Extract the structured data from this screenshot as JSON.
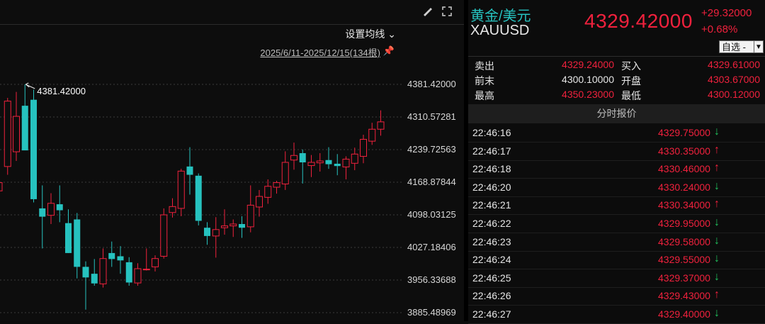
{
  "chart": {
    "ma_selector": "设置均线",
    "date_range": "2025/6/11-2025/12/15(134根)",
    "icons": {
      "draw": "brush-icon",
      "fullscreen": "expand-icon",
      "pin": "pin-icon"
    },
    "high_marker": "4381.42000",
    "y_ticks": [
      "4381.42000",
      "4310.57281",
      "4239.72563",
      "4168.87844",
      "4098.03125",
      "4027.18406",
      "3956.33688",
      "3885.48969"
    ]
  },
  "chart_data": {
    "type": "candlestick",
    "ylim": [
      3885.48969,
      4381.42
    ],
    "up_color": "#f0213d",
    "down_color": "#26c2bf",
    "candles": [
      {
        "o": 4150,
        "h": 4185,
        "l": 4138,
        "c": 4168
      },
      {
        "o": 4203,
        "h": 4352,
        "l": 4185,
        "c": 4345
      },
      {
        "o": 4235,
        "h": 4365,
        "l": 4215,
        "c": 4312
      },
      {
        "o": 4335,
        "h": 4381.42,
        "l": 4272,
        "c": 4238
      },
      {
        "o": 4348,
        "h": 4370,
        "l": 4125,
        "c": 4132
      },
      {
        "o": 4112,
        "h": 4162,
        "l": 4025,
        "c": 4094
      },
      {
        "o": 4097,
        "h": 4145,
        "l": 4078,
        "c": 4123
      },
      {
        "o": 4121,
        "h": 4162,
        "l": 4082,
        "c": 4108
      },
      {
        "o": 4080,
        "h": 4110,
        "l": 4015,
        "c": 4015
      },
      {
        "o": 4088,
        "h": 4102,
        "l": 3960,
        "c": 3985
      },
      {
        "o": 3985,
        "h": 3997,
        "l": 3892,
        "c": 3962
      },
      {
        "o": 3970,
        "h": 4002,
        "l": 3944,
        "c": 3949
      },
      {
        "o": 3948,
        "h": 4025,
        "l": 3940,
        "c": 4003
      },
      {
        "o": 4015,
        "h": 4040,
        "l": 3985,
        "c": 4002
      },
      {
        "o": 4008,
        "h": 4030,
        "l": 3970,
        "c": 3999
      },
      {
        "o": 3995,
        "h": 4006,
        "l": 3944,
        "c": 3951
      },
      {
        "o": 3950,
        "h": 3993,
        "l": 3944,
        "c": 3981
      },
      {
        "o": 3980,
        "h": 4025,
        "l": 3977,
        "c": 3980
      },
      {
        "o": 3985,
        "h": 4010,
        "l": 3975,
        "c": 4003
      },
      {
        "o": 4008,
        "h": 4112,
        "l": 4003,
        "c": 4098
      },
      {
        "o": 4103,
        "h": 4134,
        "l": 4092,
        "c": 4116
      },
      {
        "o": 4112,
        "h": 4198,
        "l": 4095,
        "c": 4193
      },
      {
        "o": 4203,
        "h": 4245,
        "l": 4142,
        "c": 4185
      },
      {
        "o": 4183,
        "h": 4188,
        "l": 4075,
        "c": 4085
      },
      {
        "o": 4070,
        "h": 4082,
        "l": 4033,
        "c": 4052
      },
      {
        "o": 4052,
        "h": 4093,
        "l": 4005,
        "c": 4066
      },
      {
        "o": 4070,
        "h": 4110,
        "l": 4055,
        "c": 4074
      },
      {
        "o": 4074,
        "h": 4088,
        "l": 4050,
        "c": 4078
      },
      {
        "o": 4078,
        "h": 4095,
        "l": 4048,
        "c": 4070
      },
      {
        "o": 4072,
        "h": 4162,
        "l": 4060,
        "c": 4119
      },
      {
        "o": 4115,
        "h": 4152,
        "l": 4094,
        "c": 4138
      },
      {
        "o": 4136,
        "h": 4175,
        "l": 4122,
        "c": 4160
      },
      {
        "o": 4158,
        "h": 4172,
        "l": 4144,
        "c": 4168
      },
      {
        "o": 4165,
        "h": 4236,
        "l": 4152,
        "c": 4212
      },
      {
        "o": 4217,
        "h": 4255,
        "l": 4196,
        "c": 4227
      },
      {
        "o": 4232,
        "h": 4240,
        "l": 4166,
        "c": 4212
      },
      {
        "o": 4205,
        "h": 4228,
        "l": 4180,
        "c": 4212
      },
      {
        "o": 4211,
        "h": 4232,
        "l": 4192,
        "c": 4215
      },
      {
        "o": 4217,
        "h": 4245,
        "l": 4198,
        "c": 4208
      },
      {
        "o": 4209,
        "h": 4230,
        "l": 4184,
        "c": 4204
      },
      {
        "o": 4202,
        "h": 4225,
        "l": 4175,
        "c": 4219
      },
      {
        "o": 4210,
        "h": 4244,
        "l": 4195,
        "c": 4230
      },
      {
        "o": 4225,
        "h": 4272,
        "l": 4210,
        "c": 4262
      },
      {
        "o": 4258,
        "h": 4298,
        "l": 4250,
        "c": 4284
      },
      {
        "o": 4284,
        "h": 4325,
        "l": 4270,
        "c": 4300
      }
    ]
  },
  "quote": {
    "symbol_cn": "黄金/美元",
    "symbol_en": "XAUUSD",
    "last": "4329.42000",
    "change": "+29.32000",
    "change_pct": "+0.68%",
    "watch_label": "自选 -",
    "rows": [
      {
        "l1": "卖出",
        "v1": "4329.24000",
        "l2": "买入",
        "v2": "4329.61000"
      },
      {
        "l1": "前末",
        "v1": "4300.10000",
        "l2": "开盘",
        "v2": "4303.67000"
      },
      {
        "l1": "最高",
        "v1": "4350.23000",
        "l2": "最低",
        "v2": "4300.12000"
      }
    ],
    "ticks_header": "分时报价",
    "ticks": [
      {
        "time": "22:46:16",
        "price": "4329.75000",
        "dir": "down"
      },
      {
        "time": "22:46:17",
        "price": "4330.35000",
        "dir": "up"
      },
      {
        "time": "22:46:18",
        "price": "4330.46000",
        "dir": "up"
      },
      {
        "time": "22:46:20",
        "price": "4330.24000",
        "dir": "down"
      },
      {
        "time": "22:46:21",
        "price": "4330.34000",
        "dir": "up"
      },
      {
        "time": "22:46:22",
        "price": "4329.95000",
        "dir": "down"
      },
      {
        "time": "22:46:23",
        "price": "4329.58000",
        "dir": "down"
      },
      {
        "time": "22:46:24",
        "price": "4329.55000",
        "dir": "down"
      },
      {
        "time": "22:46:25",
        "price": "4329.37000",
        "dir": "down"
      },
      {
        "time": "22:46:26",
        "price": "4329.43000",
        "dir": "up"
      },
      {
        "time": "22:46:27",
        "price": "4329.40000",
        "dir": "down"
      }
    ]
  }
}
